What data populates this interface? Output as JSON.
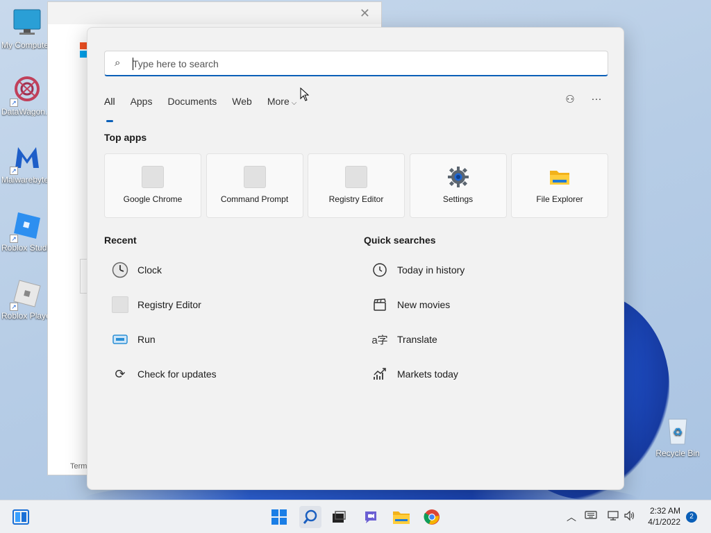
{
  "desktop": {
    "icons": [
      {
        "label": "My Computer",
        "icon": "monitor-icon"
      },
      {
        "label": "DataWagon...",
        "icon": "datawagon-icon"
      },
      {
        "label": "Malwarebytes",
        "icon": "malwarebytes-icon"
      },
      {
        "label": "Roblox Studio",
        "icon": "roblox-studio-icon"
      },
      {
        "label": "Roblox Player",
        "icon": "roblox-player-icon"
      }
    ],
    "recycle_bin": {
      "label": "Recycle Bin",
      "icon": "recycle-bin-icon"
    }
  },
  "background_window": {
    "close_glyph": "✕",
    "footer_text": "Term"
  },
  "search": {
    "placeholder": "Type here to search",
    "search_glyph": "⌕"
  },
  "tabs": [
    {
      "label": "All",
      "active": true
    },
    {
      "label": "Apps",
      "active": false
    },
    {
      "label": "Documents",
      "active": false
    },
    {
      "label": "Web",
      "active": false
    },
    {
      "label": "More",
      "active": false,
      "chevron": "⌵"
    }
  ],
  "toolbar": {
    "feedback_glyph": "⚇",
    "more_glyph": "···"
  },
  "top_apps": {
    "title": "Top apps",
    "items": [
      {
        "label": "Google Chrome",
        "icon": "placeholder-icon"
      },
      {
        "label": "Command Prompt",
        "icon": "placeholder-icon"
      },
      {
        "label": "Registry Editor",
        "icon": "placeholder-icon"
      },
      {
        "label": "Settings",
        "icon": "gear-icon"
      },
      {
        "label": "File Explorer",
        "icon": "folder-icon"
      }
    ]
  },
  "recent": {
    "title": "Recent",
    "items": [
      {
        "label": "Clock",
        "icon": "clock-icon",
        "glyph": "🕒"
      },
      {
        "label": "Registry Editor",
        "icon": "placeholder-icon",
        "glyph": ""
      },
      {
        "label": "Run",
        "icon": "run-icon",
        "glyph": "▭"
      },
      {
        "label": "Check for updates",
        "icon": "refresh-icon",
        "glyph": "⟳"
      }
    ]
  },
  "quick_searches": {
    "title": "Quick searches",
    "items": [
      {
        "label": "Today in history",
        "icon": "history-clock-icon",
        "glyph": "◷"
      },
      {
        "label": "New movies",
        "icon": "clapperboard-icon",
        "glyph": "🎬"
      },
      {
        "label": "Translate",
        "icon": "translate-icon",
        "glyph": "a字"
      },
      {
        "label": "Markets today",
        "icon": "chart-icon",
        "glyph": "📈"
      }
    ]
  },
  "taskbar": {
    "clock_time": "2:32 AM",
    "clock_date": "4/1/2022",
    "notification_count": "2",
    "tray_chevron": "︿"
  },
  "colors": {
    "accent": "#0a5fb8",
    "panel_bg": "#f2f2f2"
  }
}
